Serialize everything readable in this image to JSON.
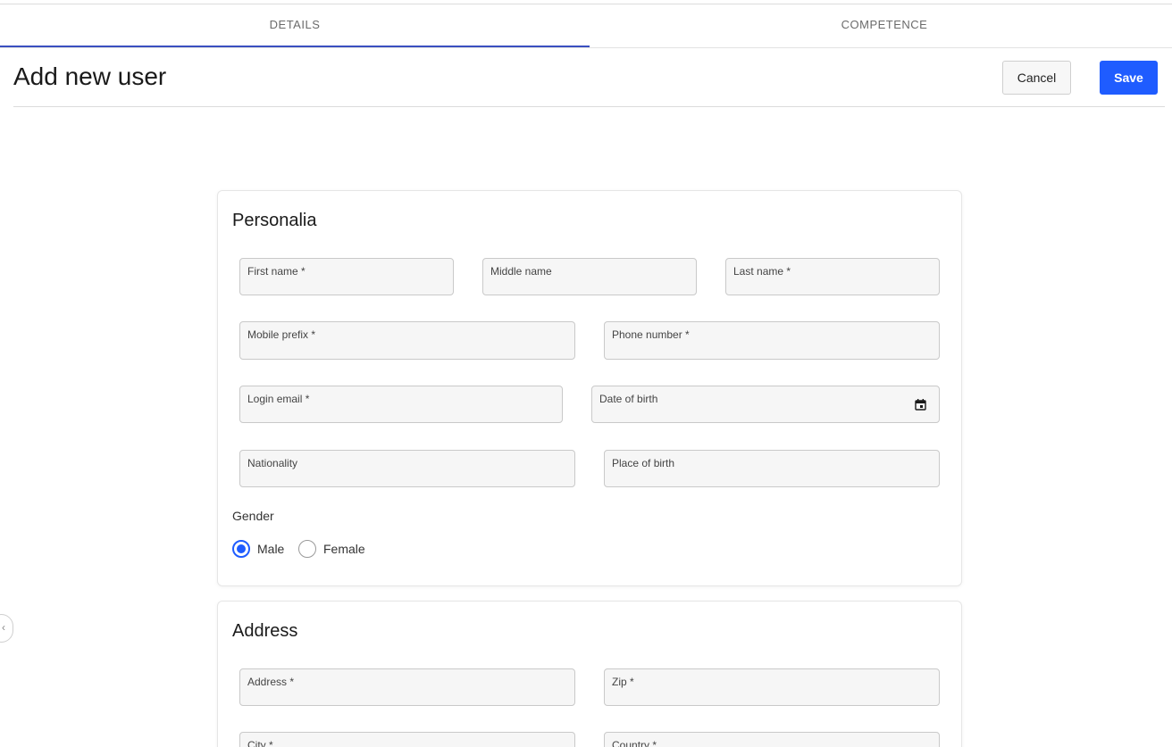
{
  "tabs": [
    {
      "label": "DETAILS",
      "active": true
    },
    {
      "label": "COMPETENCE",
      "active": false
    }
  ],
  "header": {
    "title": "Add new user",
    "cancel_label": "Cancel",
    "save_label": "Save"
  },
  "colors": {
    "accent": "#1f5cff",
    "tab_indicator": "#3a4fc0",
    "error": "#e53935"
  },
  "personalia": {
    "title": "Personalia",
    "first_name": "First name",
    "middle_name": "Middle name",
    "last_name": "Last name *",
    "mobile_prefix": "Mobile prefix *",
    "phone_number": "Phone number *",
    "login_email": "Login email *",
    "date_of_birth": "Date of birth",
    "nationality": "Nationality",
    "place_of_birth": "Place of birth",
    "gender_label": "Gender",
    "gender_male": "Male",
    "gender_female": "Female",
    "gender_selected": "Male"
  },
  "address": {
    "title": "Address",
    "address": "Address *",
    "zip": "Zip *",
    "city": "City *",
    "country": "Country *"
  },
  "icons": {
    "calendar": "calendar-icon",
    "side_handle": "chevron-left-icon"
  }
}
